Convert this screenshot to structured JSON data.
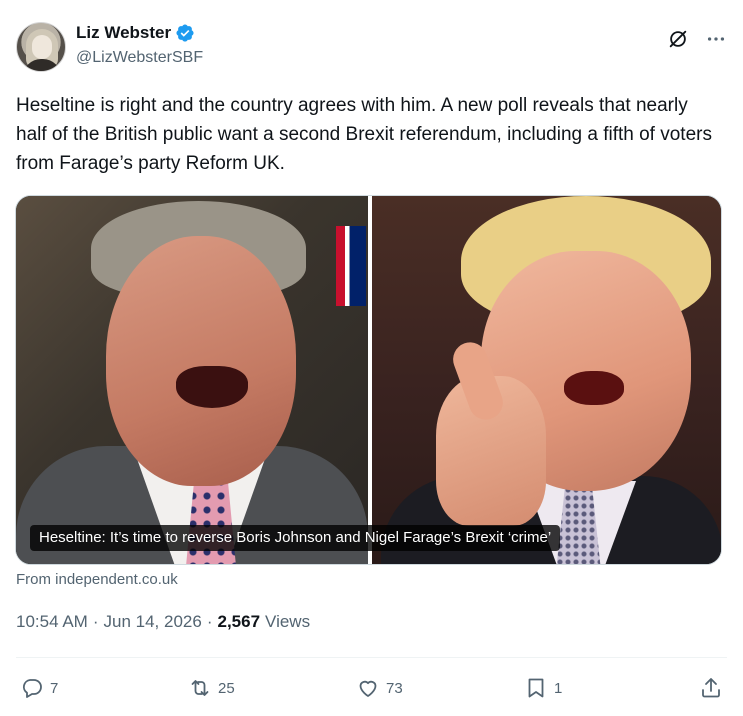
{
  "author": {
    "display_name": "Liz Webster",
    "handle": "@LizWebsterSBF",
    "verified": true
  },
  "tweet": {
    "text": "Heseltine is right and the country agrees with him. A new poll reveals that nearly half of the British public want a second Brexit referendum, including a fifth of voters from Farage’s party Reform UK."
  },
  "card": {
    "caption": "Heseltine: It’s time to reverse Boris Johnson and Nigel Farage’s Brexit ‘crime’",
    "source": "From independent.co.uk"
  },
  "meta": {
    "time": "10:54 AM",
    "date": "Jun 14, 2026",
    "separator": "·",
    "views_count": "2,567",
    "views_label": "Views"
  },
  "actions": {
    "replies": "7",
    "reposts": "25",
    "likes": "73",
    "bookmarks": "1"
  },
  "colors": {
    "verified_blue": "#1d9bf0",
    "muted_text": "#536471",
    "primary_text": "#0f1419"
  },
  "icons": {
    "verified": "verified-badge-icon",
    "grok": "grok-icon",
    "more": "more-icon",
    "reply": "reply-icon",
    "repost": "repost-icon",
    "like": "heart-icon",
    "bookmark": "bookmark-icon",
    "share": "share-icon"
  }
}
